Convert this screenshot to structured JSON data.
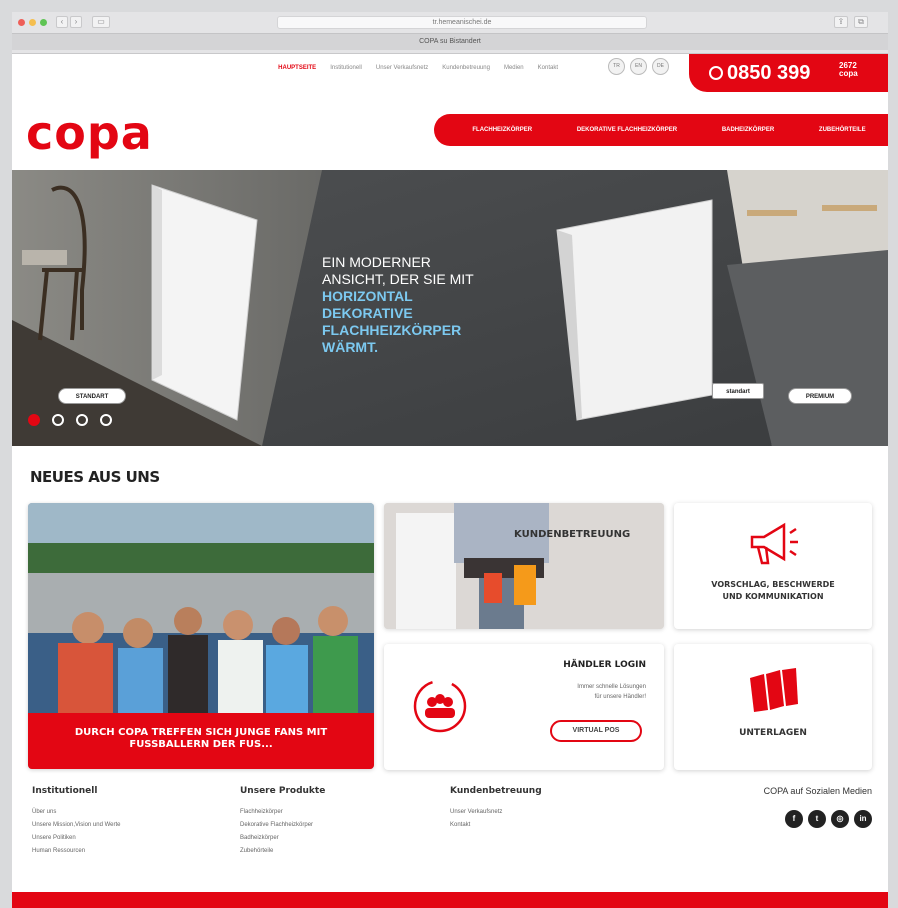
{
  "browser": {
    "url": "tr.hemeanischei.de",
    "tab_title": "COPA su Bistandert"
  },
  "top_nav": {
    "items": [
      "HAUPTSEITE",
      "Institutionell",
      "Unser Verkaufsnetz",
      "Kundenbetreuung",
      "Medien",
      "Kontakt"
    ],
    "active": "HAUPTSEITE",
    "languages": [
      "TR",
      "EN",
      "DE"
    ]
  },
  "phone": {
    "number": "0850 399",
    "suffix_top": "2672",
    "suffix_bottom": "copa"
  },
  "brand": {
    "logo": "copa",
    "accent": "#e30613"
  },
  "main_nav": [
    "FLACHHEIZKÖRPER",
    "DEKORATIVE FLACHHEIZKÖRPER",
    "BADHEIZKÖRPER",
    "ZUBEHÖRTEILE"
  ],
  "hero": {
    "line1": "EIN MODERNER",
    "line2": "ANSICHT, DER SIE MIT",
    "highlight1": "HORIZONTAL",
    "highlight2": "DEKORATIVE",
    "highlight3": "FLACHHEIZKÖRPER",
    "highlight4": "WÄRMT.",
    "label_left": "STANDART",
    "label_mid": "standart",
    "label_right": "PREMIUM",
    "slides": 4,
    "active_slide": 1
  },
  "news": {
    "title": "NEUES AUS UNS",
    "fans_caption": "DURCH COPA TREFFEN SICH JUNGE FANS MIT FUSSBALLERN DER FUS...",
    "service_label": "KUNDENBETREUUNG",
    "feedback_label_1": "VORSCHLAG, BESCHWERDE",
    "feedback_label_2": "UND KOMMUNIKATION",
    "login_title": "HÄNDLER LOGIN",
    "login_text_1": "Immer schnelle Lösungen",
    "login_text_2": "für unsere Händler!",
    "login_button": "VIRTUAL POS",
    "docs_label": "UNTERLAGEN"
  },
  "footer": {
    "col1": {
      "title": "Institutionell",
      "items": [
        "Über uns",
        "Unsere Mission,Vision und Werte",
        "Unsere Politiken",
        "Human Ressourcen"
      ]
    },
    "col2": {
      "title": "Unsere Produkte",
      "items": [
        "Flachheizkörper",
        "Dekorative Flachheizkörper",
        "Badheizkörper",
        "Zubehörteile"
      ]
    },
    "col3": {
      "title": "Kundenbetreuung",
      "items": [
        "Unser Verkaufsnetz",
        "Kontakt"
      ]
    },
    "social_title": "COPA auf Sozialen Medien",
    "social_icons": [
      "facebook-icon",
      "twitter-icon",
      "instagram-icon",
      "linkedin-icon"
    ]
  }
}
